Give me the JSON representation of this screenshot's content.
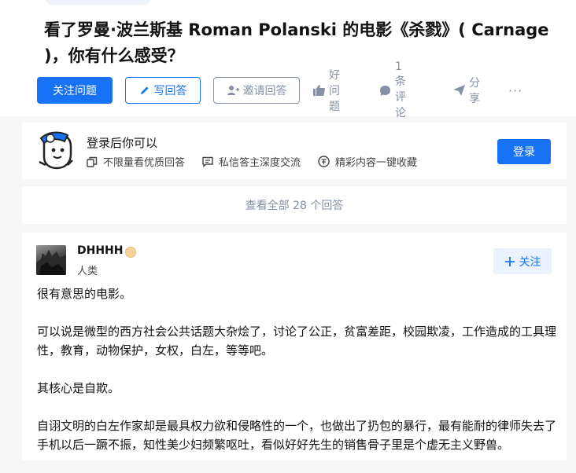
{
  "question": {
    "title": "看了罗曼·波兰斯基 Roman Polanski 的电影《杀戮》( Carnage )，你有什么感受？"
  },
  "actions": {
    "follow_label": "关注问题",
    "answer_label": "写回答",
    "invite_label": "邀请回答",
    "good_question_label": "好问题",
    "comment_label": "1 条评论",
    "share_label": "分享",
    "more_label": "···"
  },
  "login_prompt": {
    "title": "登录后你可以",
    "benefits": [
      "不限量看优质回答",
      "私信答主深度交流",
      "精彩内容一键收藏"
    ],
    "login_label": "登录"
  },
  "view_all": {
    "label": "查看全部 28 个回答"
  },
  "answer": {
    "author_name": "DHHHH",
    "author_tag": "人类",
    "follow_label": "关注",
    "paragraphs": [
      "很有意思的电影。",
      "可以说是微型的西方社会公共话题大杂烩了，讨论了公正，贫富差距，校园欺凌，工作造成的工具理性，教育，动物保护，女权，白左，等等吧。",
      "其核心是自欺。",
      "自诩文明的白左作家却是最具权力欲和侵略性的一个，也做出了扔包的暴行，最有能耐的律师失去了手机以后一蹶不振，知性美少妇频繁呕吐，看似好好先生的销售骨子里是个虚无主义野兽。"
    ]
  },
  "colors": {
    "brand": "#1772f6",
    "muted": "#8590a6"
  }
}
